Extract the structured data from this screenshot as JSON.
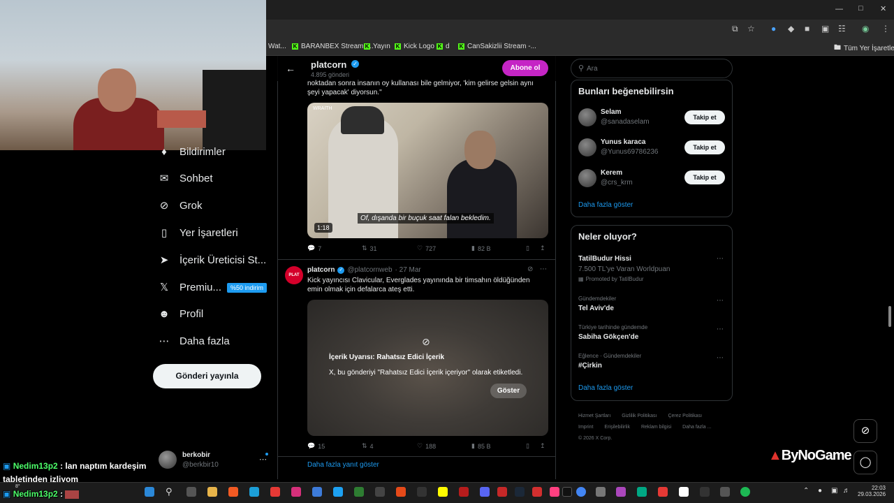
{
  "browser": {
    "bookmarks": [
      {
        "label": "Wat..."
      },
      {
        "label": "BARANBEX Stream -..."
      },
      {
        "label": "Yayın"
      },
      {
        "label": "Kick Logo"
      },
      {
        "label": "d"
      },
      {
        "label": "CanSakizlii Stream -..."
      }
    ],
    "all_bookmarks": "Tüm Yer İşaretleri"
  },
  "header": {
    "name": "platcorn",
    "post_count": "4.895 gönderi",
    "subscribe_label": "Abone ol"
  },
  "nav": {
    "notifications": "Bildirimler",
    "chat": "Sohbet",
    "grok": "Grok",
    "bookmarks": "Yer İşaretleri",
    "creator": "İçerik Üreticisi St...",
    "premium": "Premiu...",
    "premium_badge": "%50 indirim",
    "profile": "Profil",
    "more": "Daha fazla",
    "post_button": "Gönderi yayınla",
    "account_name": "berkobir",
    "account_handle": "@berkbir10"
  },
  "tweet1": {
    "text_line1": "noktadan sonra insanın oy kullanası bile gelmiyor, 'kim gelirse gelsin aynı",
    "text_line2": "şeyi yapacak' diyorsun.\"",
    "video_tag": "WRAITH",
    "subtitle": "Of, dışanda bir buçuk saat falan bekledim.",
    "duration": "1:18",
    "replies": "7",
    "reposts": "31",
    "likes": "727",
    "views": "82 B"
  },
  "tweet2": {
    "name": "platcorn",
    "handle": "@platcornweb",
    "date": "· 27 Mar",
    "text_line1": "Kick yayıncısı Clavicular, Everglades yayınında bir timsahın öldüğünden",
    "text_line2": "emin olmak için defalarca ateş etti.",
    "warning_title": "İçerik Uyarısı: Rahatsız Edici İçerik",
    "warning_text": "X, bu gönderiyi \"Rahatsız Edici İçerik içeriyor\" olarak etiketledi.",
    "show_label": "Göster",
    "replies": "15",
    "reposts": "4",
    "likes": "188",
    "views": "85 B"
  },
  "more_replies": "Daha fazla yanıt göster",
  "search": {
    "placeholder": "Ara"
  },
  "suggestions": {
    "title": "Bunları beğenebilirsin",
    "follow_label": "Takip et",
    "users": [
      {
        "name": "Selam",
        "handle": "@sanadaselam"
      },
      {
        "name": "Yunus karaca",
        "handle": "@Yunus69786236"
      },
      {
        "name": "Kerem",
        "handle": "@crs_krm"
      }
    ],
    "show_more": "Daha fazla göster"
  },
  "trends": {
    "title": "Neler oluyor?",
    "items": [
      {
        "context": "",
        "name": "TatilBudur Hissi",
        "sub": "7.500 TL'ye Varan Worldpuan",
        "promo": "Promoted by TatilBudur"
      },
      {
        "context": "Gündemdekiler",
        "name": "Tel Aviv'de"
      },
      {
        "context": "Türkiye tarihinde gündemde",
        "name": "Sabiha Gökçen'de"
      },
      {
        "context": "Eğlence · Gündemdekiler",
        "name": "#Çirkin"
      }
    ],
    "show_more": "Daha fazla göster"
  },
  "footer": {
    "links": [
      "Hizmet Şartları",
      "Gizlilik Politikası",
      "Çerez Politikası",
      "Imprint",
      "Erişilebilirlik",
      "Reklam bilgisi",
      "Daha fazla ..."
    ],
    "copyright": "© 2026 X Corp."
  },
  "overlay": {
    "brand": "ByNoGame",
    "chat": [
      {
        "nick": "Nedim13p2",
        "message": ": lan naptım kardeşim"
      },
      {
        "nick": "",
        "message": "tabletinden izliyom"
      },
      {
        "nick": "Nedim13p2",
        "message": ":"
      }
    ]
  },
  "taskbar": {
    "time": "22:03",
    "date": "29.03.2026",
    "temp": "8°"
  }
}
